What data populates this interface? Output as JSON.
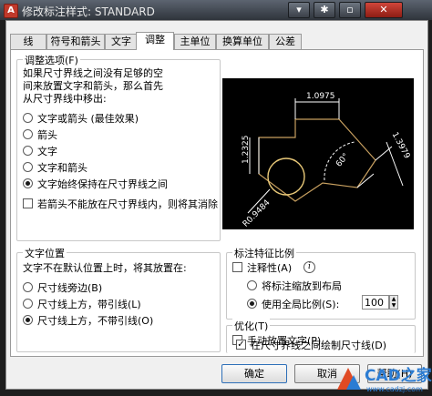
{
  "window": {
    "title": "修改标注样式: STANDARD",
    "buttons": [
      "▾",
      "✱",
      "▫",
      "✕"
    ]
  },
  "tabs": [
    "线",
    "符号和箭头",
    "文字",
    "调整",
    "主单位",
    "换算单位",
    "公差"
  ],
  "fit_options": {
    "legend": "调整选项(F)",
    "description": [
      "如果尺寸界线之间没有足够的空",
      "间来放置文字和箭头，那么首先",
      "从尺寸界线中移出:"
    ],
    "options": [
      "文字或箭头 (最佳效果)",
      "箭头",
      "文字",
      "文字和箭头",
      "文字始终保持在尺寸界线之间"
    ],
    "selected": 4,
    "suppress_label": "若箭头不能放在尺寸界线内，则将其消除",
    "suppress_checked": false
  },
  "preview": {
    "dims": [
      "1.0975",
      "1.2325",
      "1.3979",
      "60°",
      "R0.9484"
    ]
  },
  "text_placement": {
    "legend": "文字位置",
    "description": "文字不在默认位置上时，将其放置在:",
    "options": [
      "尺寸线旁边(B)",
      "尺寸线上方，带引线(L)",
      "尺寸线上方，不带引线(O)"
    ],
    "selected": 2
  },
  "scale": {
    "legend": "标注特征比例",
    "annotative_label": "注释性(A)",
    "annotative_checked": false,
    "layout_label": "将标注缩放到布局",
    "global_label": "使用全局比例(S):",
    "selected": 1,
    "global_value": "100"
  },
  "fine_tuning": {
    "legend": "优化(T)",
    "manual_label": "手动放置文字(P)",
    "manual_checked": false,
    "draw_label": "在尺寸界线之间绘制尺寸线(D)",
    "draw_checked": true
  },
  "footer": {
    "ok": "确定",
    "cancel": "取消",
    "help": "帮助(H)"
  },
  "watermark": {
    "brand": "CAD之家",
    "url": "www.cadzj.com"
  }
}
